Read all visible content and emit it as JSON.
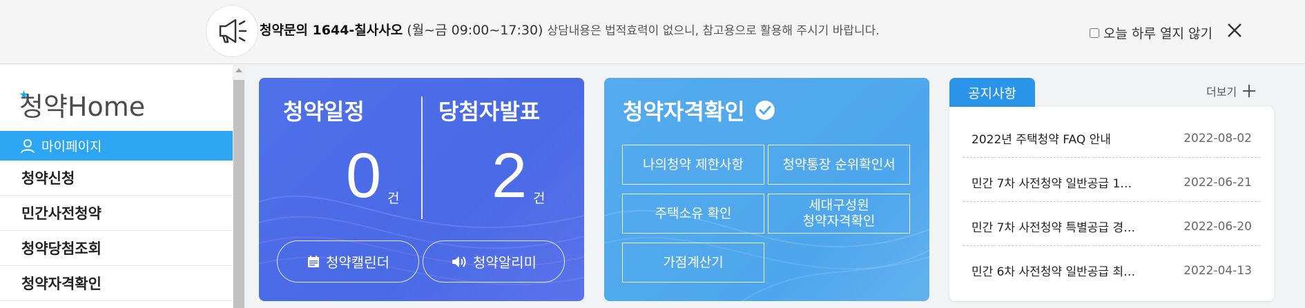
{
  "topbar": {
    "notice_bold": "청약문의 1644-칠사사오",
    "notice_hours": "(월~금 09:00~17:30)",
    "notice_rest": "상담내용은 법적효력이 없으니, 참고용으로 활용해 주시기 바랍니다.",
    "dont_show_label": "오늘 하루 열지 않기",
    "icons": {
      "megaphone": "megaphone-icon",
      "close": "close-icon"
    }
  },
  "sidebar": {
    "logo_text": "청약Home",
    "active_item": "마이페이지",
    "items": [
      {
        "label": "청약신청"
      },
      {
        "label": "민간사전청약"
      },
      {
        "label": "청약당첨조회"
      },
      {
        "label": "청약자격확인"
      }
    ]
  },
  "schedule_card": {
    "schedule_title": "청약일정",
    "schedule_count": "0",
    "winner_title": "당첨자발표",
    "winner_count": "2",
    "unit": "건",
    "calendar_button": "청약캘린더",
    "alarm_button": "청약알리미"
  },
  "qualify_card": {
    "title": "청약자격확인",
    "buttons": [
      {
        "label": "나의청약 제한사항"
      },
      {
        "label": "청약통장 순위확인서"
      },
      {
        "label": "주택소유 확인"
      },
      {
        "label_line1": "세대구성원",
        "label_line2": "청약자격확인"
      },
      {
        "label": "가점계산기"
      }
    ]
  },
  "notice_panel": {
    "tab_label": "공지사항",
    "more_label": "더보기",
    "items": [
      {
        "title": "2022년 주택청약 FAQ 안내",
        "date": "2022-08-02"
      },
      {
        "title": "민간 7차 사전청약 일반공급 1…",
        "date": "2022-06-21"
      },
      {
        "title": "민간 7차 사전청약 특별공급 경…",
        "date": "2022-06-20"
      },
      {
        "title": "민간 6차 사전청약 일반공급 최…",
        "date": "2022-04-13"
      }
    ]
  },
  "colors": {
    "card_schedule": "#4e70e8",
    "card_qualify": "#54abee",
    "sidebar_active": "#2ca6f2",
    "notice_tab": "#2a95e8"
  }
}
